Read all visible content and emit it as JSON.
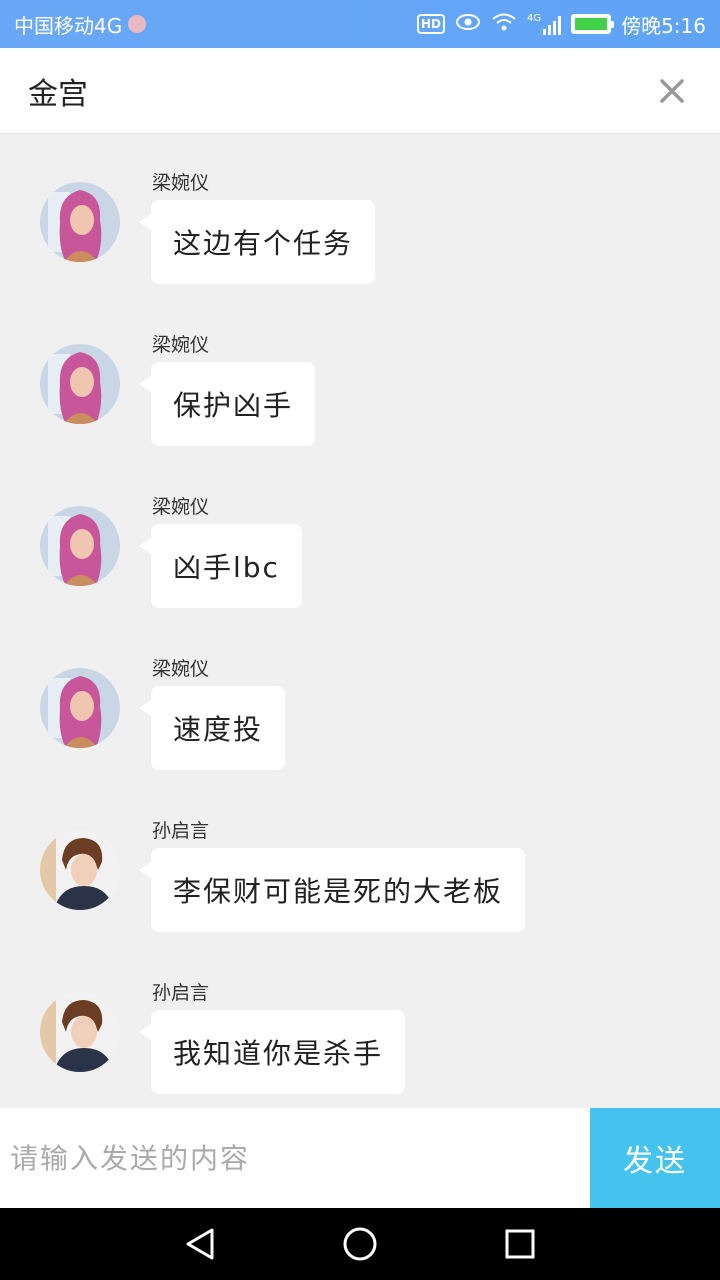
{
  "status_bar": {
    "carrier": "中国移动4G",
    "network": "4G",
    "time": "傍晚5:16",
    "battery_color": "#43d14a"
  },
  "header": {
    "title": "金宫",
    "close_icon": "close-icon"
  },
  "messages": [
    {
      "sender": "梁婉仪",
      "text": "这边有个任务",
      "avatar": "female-avatar"
    },
    {
      "sender": "梁婉仪",
      "text": "保护凶手",
      "avatar": "female-avatar"
    },
    {
      "sender": "梁婉仪",
      "text": "凶手lbc",
      "avatar": "female-avatar"
    },
    {
      "sender": "梁婉仪",
      "text": "速度投",
      "avatar": "female-avatar"
    },
    {
      "sender": "孙启言",
      "text": "李保财可能是死的大老板",
      "avatar": "male-avatar"
    },
    {
      "sender": "孙启言",
      "text": "我知道你是杀手",
      "avatar": "male-avatar"
    }
  ],
  "input_bar": {
    "placeholder": "请输入发送的内容",
    "value": "",
    "send_label": "发送",
    "send_color": "#45c3ee"
  },
  "nav_bar": {
    "back_icon": "back-triangle-icon",
    "home_icon": "home-circle-icon",
    "recent_icon": "recent-square-icon"
  }
}
